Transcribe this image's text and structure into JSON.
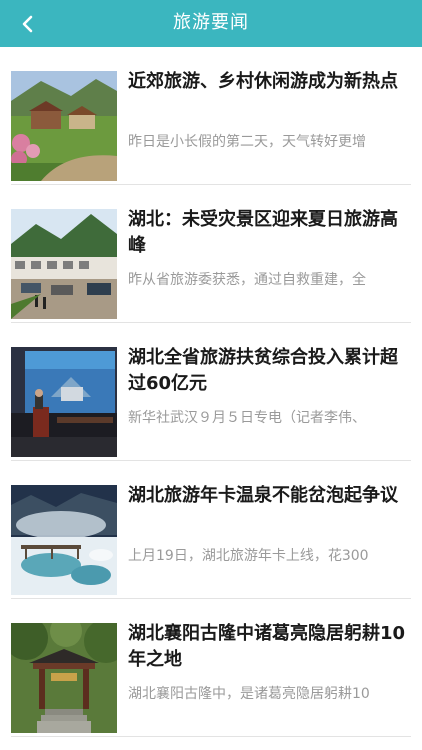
{
  "header": {
    "title": "旅游要闻",
    "back_icon": "chevron-left-icon",
    "background_color": "#3bb6bf"
  },
  "news": [
    {
      "headline": "近郊旅游、乡村休闲游成为新热点",
      "summary": "昨日是小长假的第二天，天气转好更增"
    },
    {
      "headline": "湖北：未受灾景区迎来夏日旅游高峰",
      "summary": "昨从省旅游委获悉，通过自救重建，全"
    },
    {
      "headline": "湖北全省旅游扶贫综合投入累计超过60亿元",
      "summary": "新华社武汉９月５日专电（记者李伟、"
    },
    {
      "headline": "湖北旅游年卡温泉不能岔泡起争议",
      "summary": "上月19日，湖北旅游年卡上线，花300"
    },
    {
      "headline": "湖北襄阳古隆中诸葛亮隐居躬耕10年之地",
      "summary": "湖北襄阳古隆中，是诸葛亮隐居躬耕10"
    }
  ]
}
